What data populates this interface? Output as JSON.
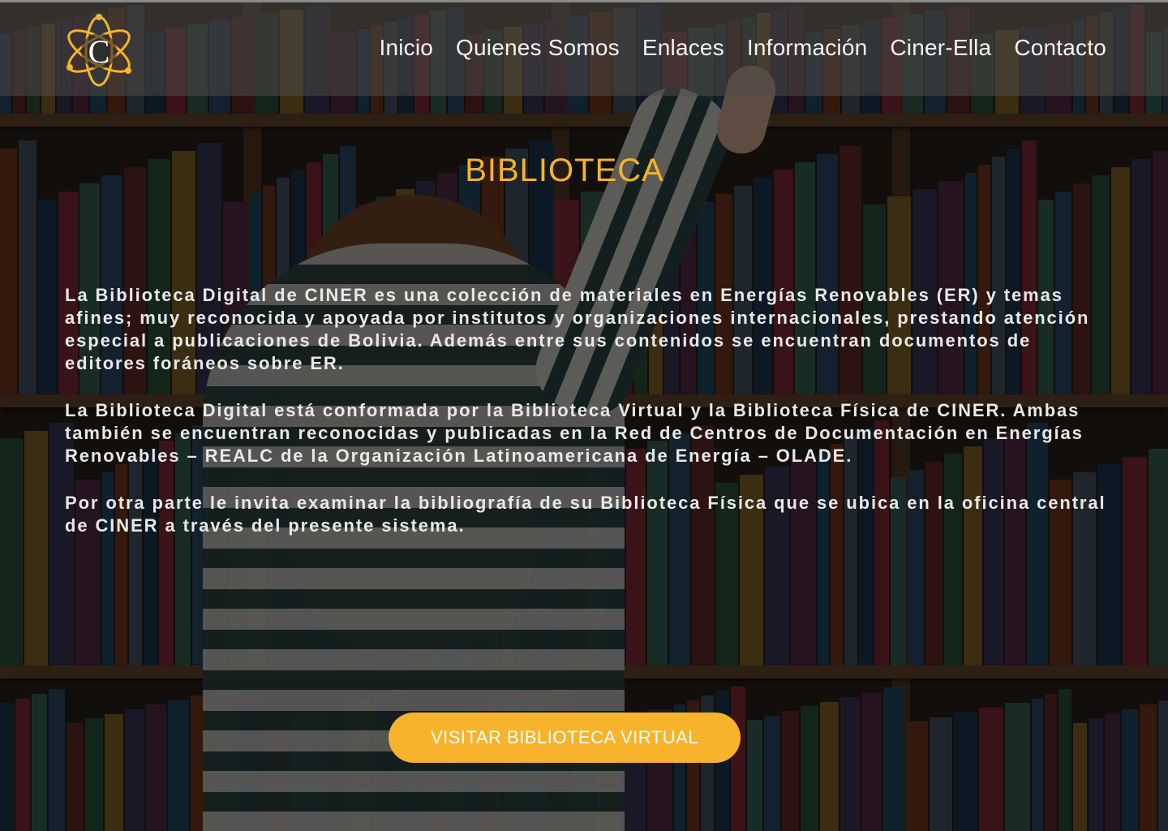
{
  "brand": {
    "logo_letter": "C",
    "accent": "#f7b32b"
  },
  "nav": {
    "items": [
      {
        "label": "Inicio"
      },
      {
        "label": "Quienes Somos"
      },
      {
        "label": "Enlaces"
      },
      {
        "label": "Información"
      },
      {
        "label": "Ciner-Ella"
      },
      {
        "label": "Contacto"
      }
    ]
  },
  "main": {
    "title": "BIBLIOTECA",
    "paragraphs": [
      "La Biblioteca Digital de CINER es una colección de materiales en Energías Renovables (ER) y temas afines; muy reconocida y apoyada por institutos y organizaciones internacionales, prestando atención especial a publicaciones de Bolivia. Además entre sus contenidos se encuentran documentos de editores foráneos sobre ER.",
      "La Biblioteca Digital está conformada por la Biblioteca Virtual y la Biblioteca Física de CINER. Ambas también se encuentran reconocidas y publicadas en la Red de Centros de Documentación en Energías Renovables – REALC de la Organización Latinoamericana de Energía – OLADE.",
      "Por otra parte le invita examinar la bibliografía de su Biblioteca Física que se ubica en la oficina central de CINER a través del presente sistema."
    ],
    "cta_label": "VISITAR BIBLIOTECA VIRTUAL"
  }
}
